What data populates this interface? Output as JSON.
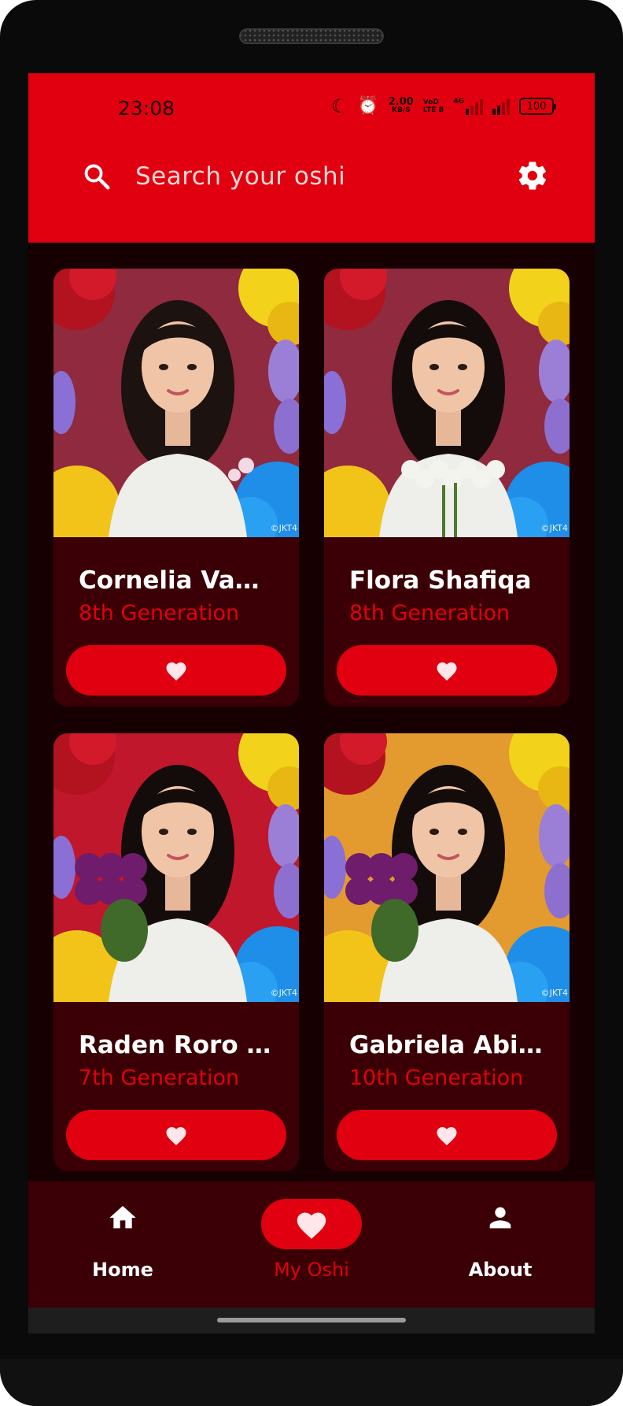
{
  "status_bar": {
    "time": "23:08",
    "speed_value": "2.00",
    "speed_unit": "KB/S",
    "volte_top": "VoD",
    "volte_bottom": "LTE B",
    "network_type": "4G",
    "battery": "100"
  },
  "search": {
    "placeholder": "Search your oshi",
    "icon": "search-icon",
    "settings_icon": "gear-icon"
  },
  "members": [
    {
      "name": "Cornelia Vanisa",
      "generation": "8th Generation",
      "copyright": "©JKT4",
      "bg": "#8f2a3f",
      "hair": "#1c120f",
      "flowers": "none",
      "favorite_icon": "heart-icon"
    },
    {
      "name": "Flora Shafiqa",
      "generation": "8th Generation",
      "copyright": "©JKT4",
      "bg": "#8f2a3f",
      "hair": "#140c0b",
      "flowers": "white",
      "favorite_icon": "heart-icon"
    },
    {
      "name": "Raden Roro Fr...",
      "generation": "7th Generation",
      "copyright": "©JKT4",
      "bg": "#c0172d",
      "hair": "#140c0b",
      "flowers": "purple",
      "favorite_icon": "heart-icon"
    },
    {
      "name": "Gabriela Abiga...",
      "generation": "10th Generation",
      "copyright": "©JKT4",
      "bg": "#e39a2e",
      "hair": "#140c0b",
      "flowers": "purple",
      "favorite_icon": "heart-icon"
    }
  ],
  "bottom_nav": {
    "items": [
      {
        "label": "Home",
        "icon": "home-icon",
        "active": false
      },
      {
        "label": "My Oshi",
        "icon": "heart-icon",
        "active": true
      },
      {
        "label": "About",
        "icon": "person-icon",
        "active": false
      }
    ]
  },
  "colors": {
    "accent": "#e0000f",
    "background": "#160002",
    "card": "#3a0005",
    "text": "#ffffff"
  }
}
